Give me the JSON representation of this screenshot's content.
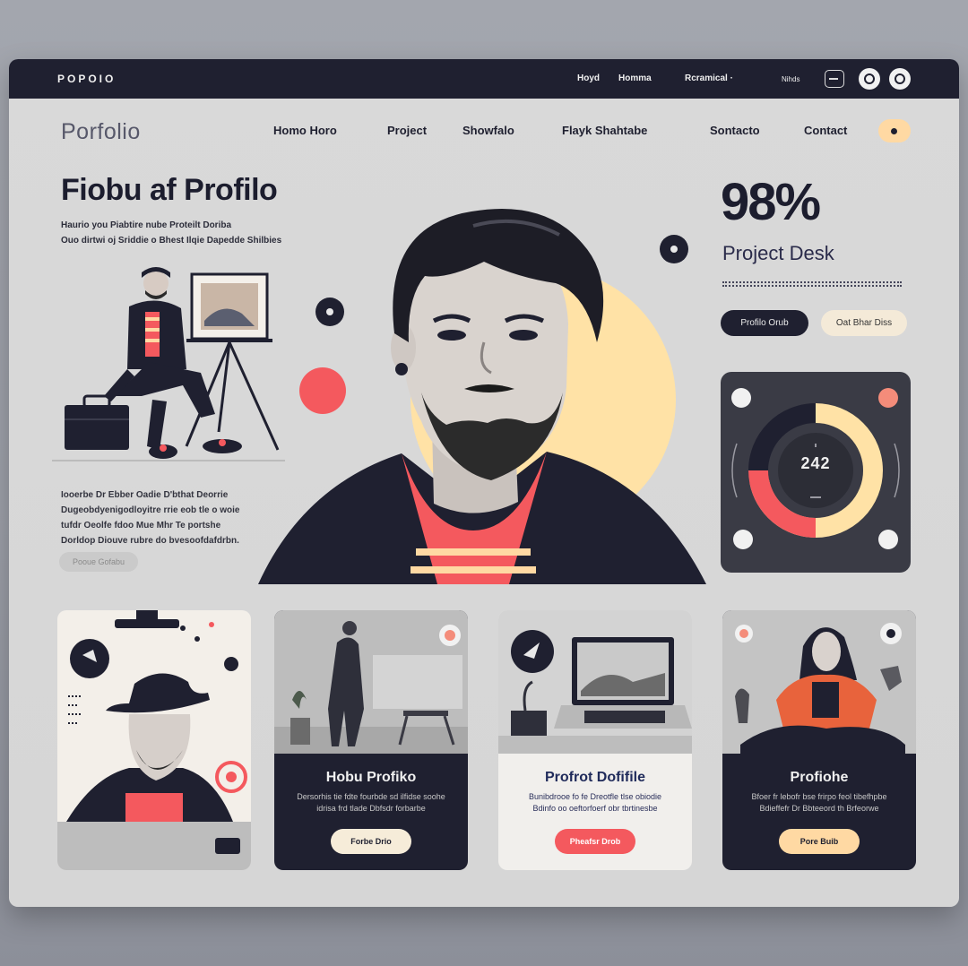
{
  "topbar": {
    "brand": "POPOIO",
    "links": [
      "Hoyd",
      "Homma",
      "Rcramical ·",
      "Nihds"
    ]
  },
  "logo": "Porfolio",
  "nav": [
    "Homo Horo",
    "Project",
    "Showfalo",
    "Flayk Shahtabe",
    "Sontacto",
    "Contact"
  ],
  "hero": {
    "title": "Fiobu af Profilo",
    "subtitle_lines": [
      "Haurio you Piabtire nube Proteilt Doriba",
      "Ouo dirtwi oj Sriddie o Bhest Ilqie Dapedde Shilbies"
    ],
    "body_lines": [
      "Iooerbe Dr Ebber Oadie D'bthat Deorrie",
      "Dugeobdyenigodloyitre rrie eob tle o woie",
      "tufdr Oeolfe fdoo Mue Mhr Te portshe",
      "Dorldop Diouve rubre do bvesoofdafdrbn."
    ],
    "button": "Pooue Gofabu"
  },
  "stat": {
    "value": "98%",
    "label": "Project Desk",
    "primary_button": "Profilo Orub",
    "secondary_button": "Oat Bhar Diss"
  },
  "gauge": {
    "value": "242",
    "fraction": 0.72
  },
  "cards": [
    {
      "title": "",
      "desc": "",
      "button": ""
    },
    {
      "title": "Hobu Profiko",
      "desc": "Dersorhis tie fdte fourbde sd ilfidse soohe idrisa frd tlade Dbfsdr forbarbe",
      "button": "Forbe Drio"
    },
    {
      "title": "Profrot Dofifile",
      "desc": "Bunibdrooe fo fe Dreotfle tlse obiodie Bdinfo oo oeftorfoerf obr tbrtinesbe",
      "button": "Pheafsr Drob"
    },
    {
      "title": "Profiohe",
      "desc": "Bfoer fr lebofr bse frirpo feol tibefhpbe Bdieffefr Dr Bbteeord th Brfeorwe",
      "button": "Pore Buib"
    }
  ],
  "colors": {
    "dark": "#1f2030",
    "cream": "#ffe2a6",
    "coral": "#f4595e",
    "panel": "#d8d8d8"
  }
}
